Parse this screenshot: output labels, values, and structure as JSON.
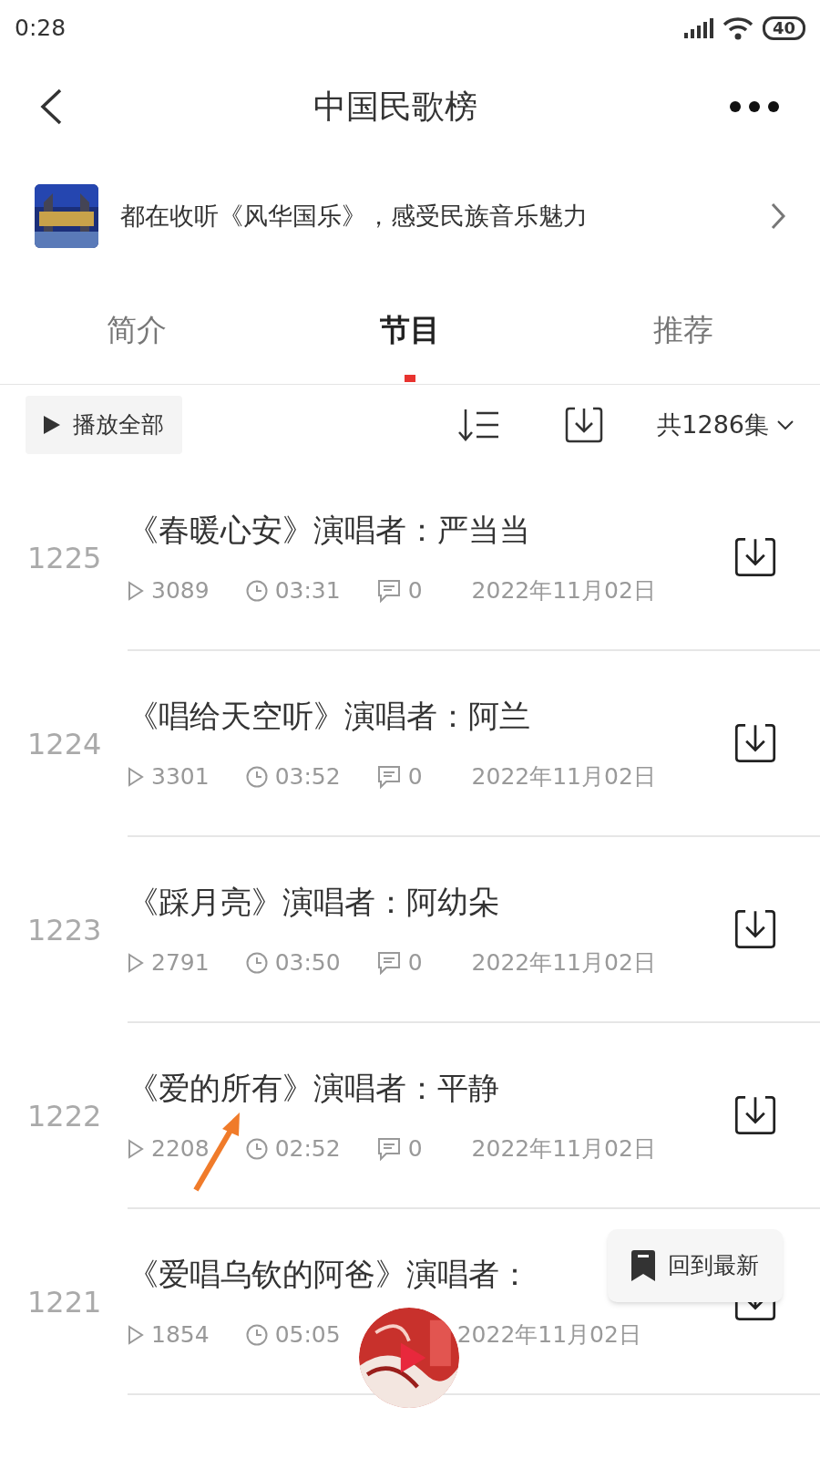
{
  "status_bar": {
    "time": "0:28",
    "battery": "40"
  },
  "header": {
    "title": "中国民歌榜"
  },
  "banner": {
    "text": "都在收听《风华国乐》，感受民族音乐魅力"
  },
  "tabs": [
    {
      "label": "简介",
      "selected": false
    },
    {
      "label": "节目",
      "selected": true
    },
    {
      "label": "推荐",
      "selected": false
    }
  ],
  "toolbar": {
    "play_all": "播放全部",
    "count": "共1286集"
  },
  "episodes": [
    {
      "number": "1225",
      "title": "《春暖心安》演唱者：严当当",
      "plays": "3089",
      "duration": "03:31",
      "comments": "0",
      "date": "2022年11月02日"
    },
    {
      "number": "1224",
      "title": "《唱给天空听》演唱者：阿兰",
      "plays": "3301",
      "duration": "03:52",
      "comments": "0",
      "date": "2022年11月02日"
    },
    {
      "number": "1223",
      "title": "《踩月亮》演唱者：阿幼朵",
      "plays": "2791",
      "duration": "03:50",
      "comments": "0",
      "date": "2022年11月02日"
    },
    {
      "number": "1222",
      "title": "《爱的所有》演唱者：平静",
      "plays": "2208",
      "duration": "02:52",
      "comments": "0",
      "date": "2022年11月02日"
    },
    {
      "number": "1221",
      "title": "《爱唱乌钦的阿爸》演唱者：",
      "plays": "1854",
      "duration": "05:05",
      "date": "2022年11月02日"
    }
  ],
  "back_to_latest": "回到最新"
}
